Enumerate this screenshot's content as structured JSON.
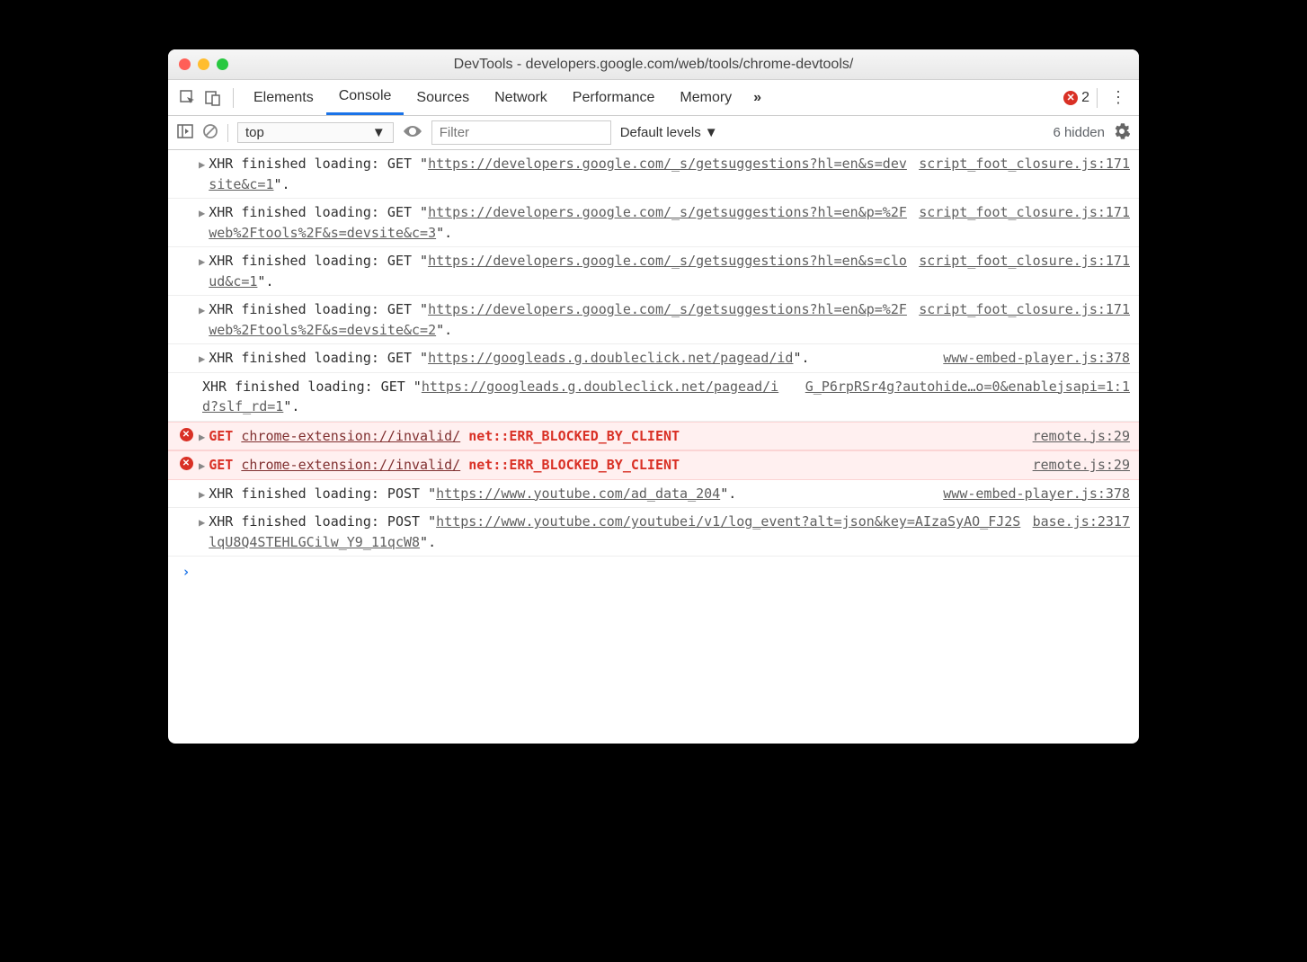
{
  "window": {
    "title": "DevTools - developers.google.com/web/tools/chrome-devtools/"
  },
  "tabs": {
    "items": [
      "Elements",
      "Console",
      "Sources",
      "Network",
      "Performance",
      "Memory"
    ],
    "active": "Console",
    "error_count": "2"
  },
  "toolbar": {
    "context": "top",
    "filter_placeholder": "Filter",
    "levels": "Default levels",
    "hidden": "6 hidden"
  },
  "console": {
    "rows": [
      {
        "type": "xhr",
        "disclosure": true,
        "prefix": "XHR finished loading: GET \"",
        "url": "https://developers.google.com/_s/getsuggestions?hl=en&s=devsite&c=1",
        "suffix": "\".",
        "source": "script_foot_closure.js:171"
      },
      {
        "type": "xhr",
        "disclosure": true,
        "prefix": "XHR finished loading: GET \"",
        "url": "https://developers.google.com/_s/getsuggestions?hl=en&p=%2Fweb%2Ftools%2F&s=devsite&c=3",
        "suffix": "\".",
        "source": "script_foot_closure.js:171"
      },
      {
        "type": "xhr",
        "disclosure": true,
        "prefix": "XHR finished loading: GET \"",
        "url": "https://developers.google.com/_s/getsuggestions?hl=en&s=cloud&c=1",
        "suffix": "\".",
        "source": "script_foot_closure.js:171"
      },
      {
        "type": "xhr",
        "disclosure": true,
        "prefix": "XHR finished loading: GET \"",
        "url": "https://developers.google.com/_s/getsuggestions?hl=en&p=%2Fweb%2Ftools%2F&s=devsite&c=2",
        "suffix": "\".",
        "source": "script_foot_closure.js:171"
      },
      {
        "type": "xhr",
        "disclosure": true,
        "prefix": "XHR finished loading: GET \"",
        "url": "https://googleads.g.doubleclick.net/pagead/id",
        "suffix": "\".",
        "source": "www-embed-player.js:378"
      },
      {
        "type": "xhr",
        "disclosure": false,
        "prefix": "XHR finished loading: GET \"",
        "url": "https://googleads.g.doubleclick.net/pagead/id?slf_rd=1",
        "suffix": "\".",
        "source": "G_P6rpRSr4g?autohide…o=0&enablejsapi=1:1"
      },
      {
        "type": "error",
        "disclosure": true,
        "method": "GET",
        "url": "chrome-extension://invalid/",
        "status": "net::ERR_BLOCKED_BY_CLIENT",
        "source": "remote.js:29"
      },
      {
        "type": "error",
        "disclosure": true,
        "method": "GET",
        "url": "chrome-extension://invalid/",
        "status": "net::ERR_BLOCKED_BY_CLIENT",
        "source": "remote.js:29"
      },
      {
        "type": "xhr",
        "disclosure": true,
        "prefix": "XHR finished loading: POST \"",
        "url": "https://www.youtube.com/ad_data_204",
        "suffix": "\".",
        "source": "www-embed-player.js:378"
      },
      {
        "type": "xhr",
        "disclosure": true,
        "prefix": "XHR finished loading: POST \"",
        "url": "https://www.youtube.com/youtubei/v1/log_event?alt=json&key=AIzaSyAO_FJ2SlqU8Q4STEHLGCilw_Y9_11qcW8",
        "suffix": "\".",
        "source": "base.js:2317"
      }
    ]
  }
}
